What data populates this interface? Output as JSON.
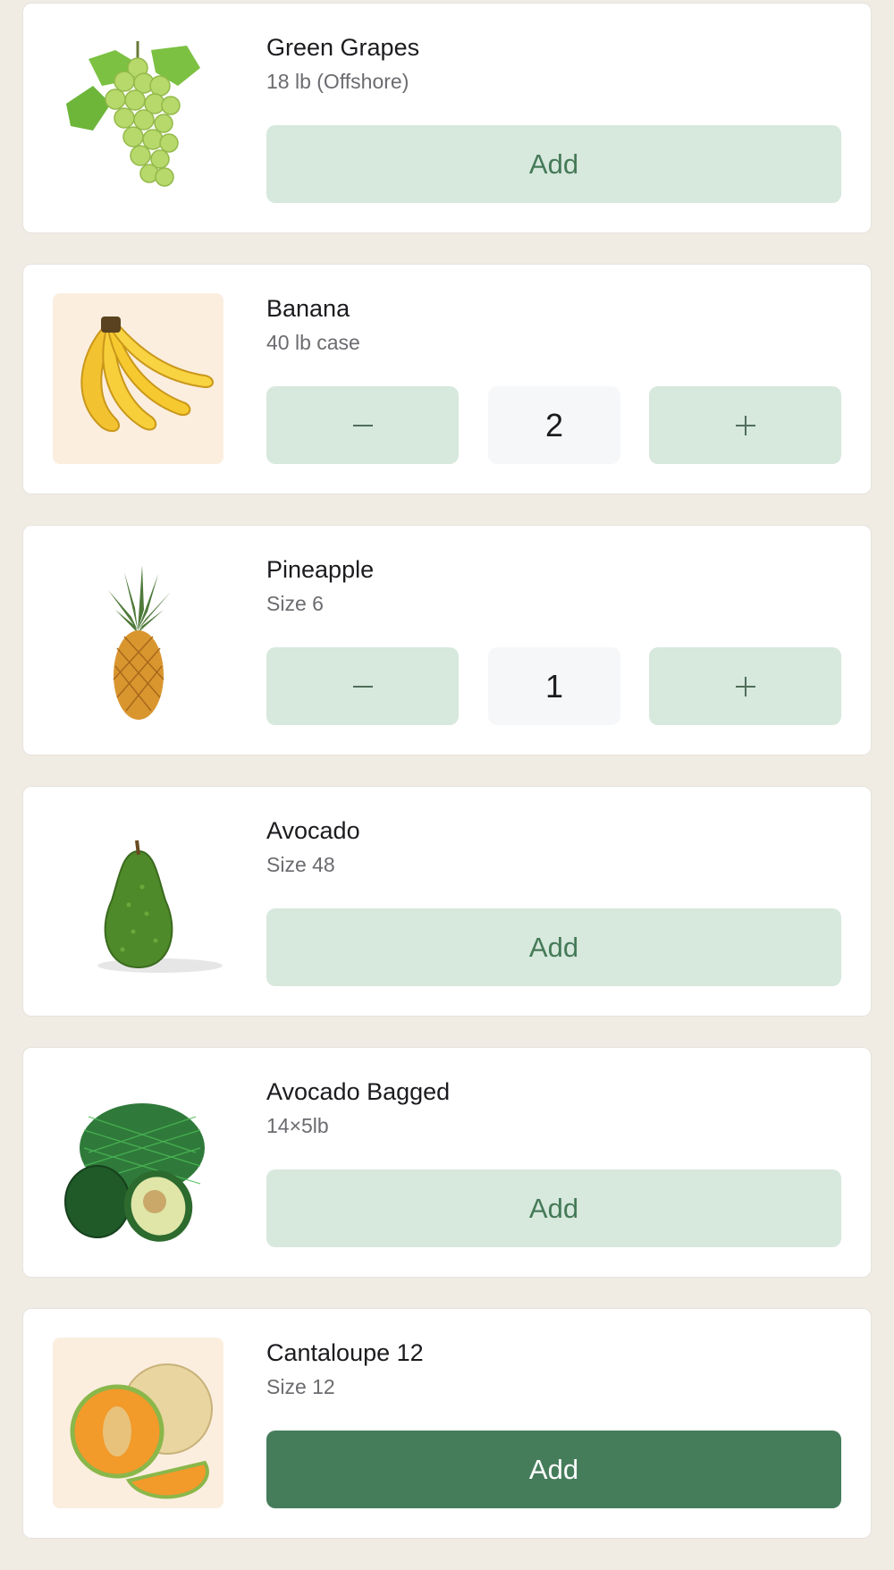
{
  "products": [
    {
      "name": "Green Grapes",
      "size": "18 lb (Offshore)",
      "action": "add",
      "add_label": "Add",
      "icon": "grapes-image"
    },
    {
      "name": "Banana",
      "size": "40 lb case",
      "action": "stepper",
      "quantity": "2",
      "icon": "banana-image"
    },
    {
      "name": "Pineapple",
      "size": "Size 6",
      "action": "stepper",
      "quantity": "1",
      "icon": "pineapple-image"
    },
    {
      "name": "Avocado",
      "size": "Size 48",
      "action": "add",
      "add_label": "Add",
      "icon": "avocado-image"
    },
    {
      "name": "Avocado Bagged",
      "size": "14×5lb",
      "action": "add",
      "add_label": "Add",
      "icon": "avocado-bag-image"
    },
    {
      "name": "Cantaloupe 12",
      "size": "Size 12",
      "action": "add",
      "add_label": "Add",
      "icon": "cantaloupe-image"
    }
  ],
  "colors": {
    "page_background": "#f0ebe3",
    "button_light": "#d7e8dd",
    "button_text": "#457a57",
    "button_primary": "#457d5b"
  }
}
